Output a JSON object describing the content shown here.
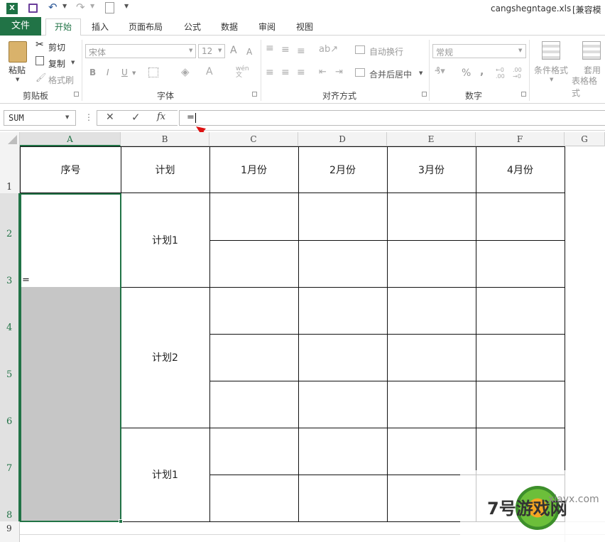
{
  "window": {
    "filename": "cangshegntage.xls",
    "compat": "[兼容模式"
  },
  "tabs": [
    "文件",
    "开始",
    "插入",
    "页面布局",
    "公式",
    "数据",
    "审阅",
    "视图"
  ],
  "ribbon": {
    "clipboard": {
      "paste": "粘贴",
      "cut": "剪切",
      "copy": "复制",
      "format_painter": "格式刷",
      "label": "剪贴板"
    },
    "font": {
      "name": "宋体",
      "size": "12",
      "bold": "B",
      "italic": "I",
      "underline": "U",
      "label": "字体",
      "grow": "A",
      "shrink": "A"
    },
    "alignment": {
      "wrap": "自动换行",
      "merge": "合并后居中",
      "label": "对齐方式"
    },
    "number": {
      "format": "常规",
      "percent": "%",
      "comma": ",",
      "label": "数字"
    },
    "styles": {
      "conditional": "条件格式",
      "table1": "套用",
      "table2": "表格格式"
    }
  },
  "formula_bar": {
    "name_box": "SUM",
    "formula": "=",
    "cancel": "✕",
    "enter": "✓",
    "fx": "fx"
  },
  "columns": [
    "A",
    "B",
    "C",
    "D",
    "E",
    "F",
    "G"
  ],
  "rows": [
    "1",
    "2",
    "3",
    "4",
    "5",
    "6",
    "7",
    "8",
    "9"
  ],
  "table": {
    "headers": [
      "序号",
      "计划",
      "1月份",
      "2月份",
      "3月份",
      "4月份"
    ],
    "plans": [
      "计划1",
      "计划2",
      "计划1"
    ],
    "editing_cell_text": "="
  },
  "watermark": {
    "brand": "7号游戏网",
    "site": "xiayx.com"
  }
}
